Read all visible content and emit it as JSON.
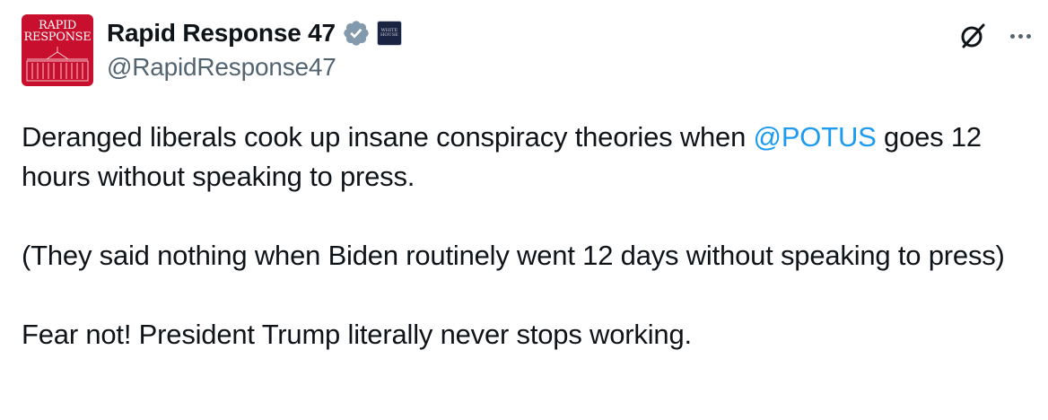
{
  "author": {
    "display_name": "Rapid Response 47",
    "handle": "@RapidResponse47",
    "avatar_text_line1": "RAPID",
    "avatar_text_line2": "RESPONSE",
    "verified_icon": "verified-badge-icon",
    "affiliate_badge_text": "WHITE HOUSE"
  },
  "controls": {
    "grok_icon": "grok-icon",
    "more_icon": "more-options-icon"
  },
  "tweet": {
    "para1_before": "Deranged liberals cook up insane conspiracy theories when ",
    "para1_mention": "@POTUS",
    "para1_after": " goes 12 hours without speaking to press.",
    "para2": "(They said nothing when Biden routinely went 12 days without speaking to press)",
    "para3": "Fear not! President Trump literally never stops working."
  },
  "colors": {
    "link": "#1d9bf0",
    "secondary_text": "#536471",
    "avatar_bg": "#c8102e",
    "verified_bg": "#829aab"
  }
}
